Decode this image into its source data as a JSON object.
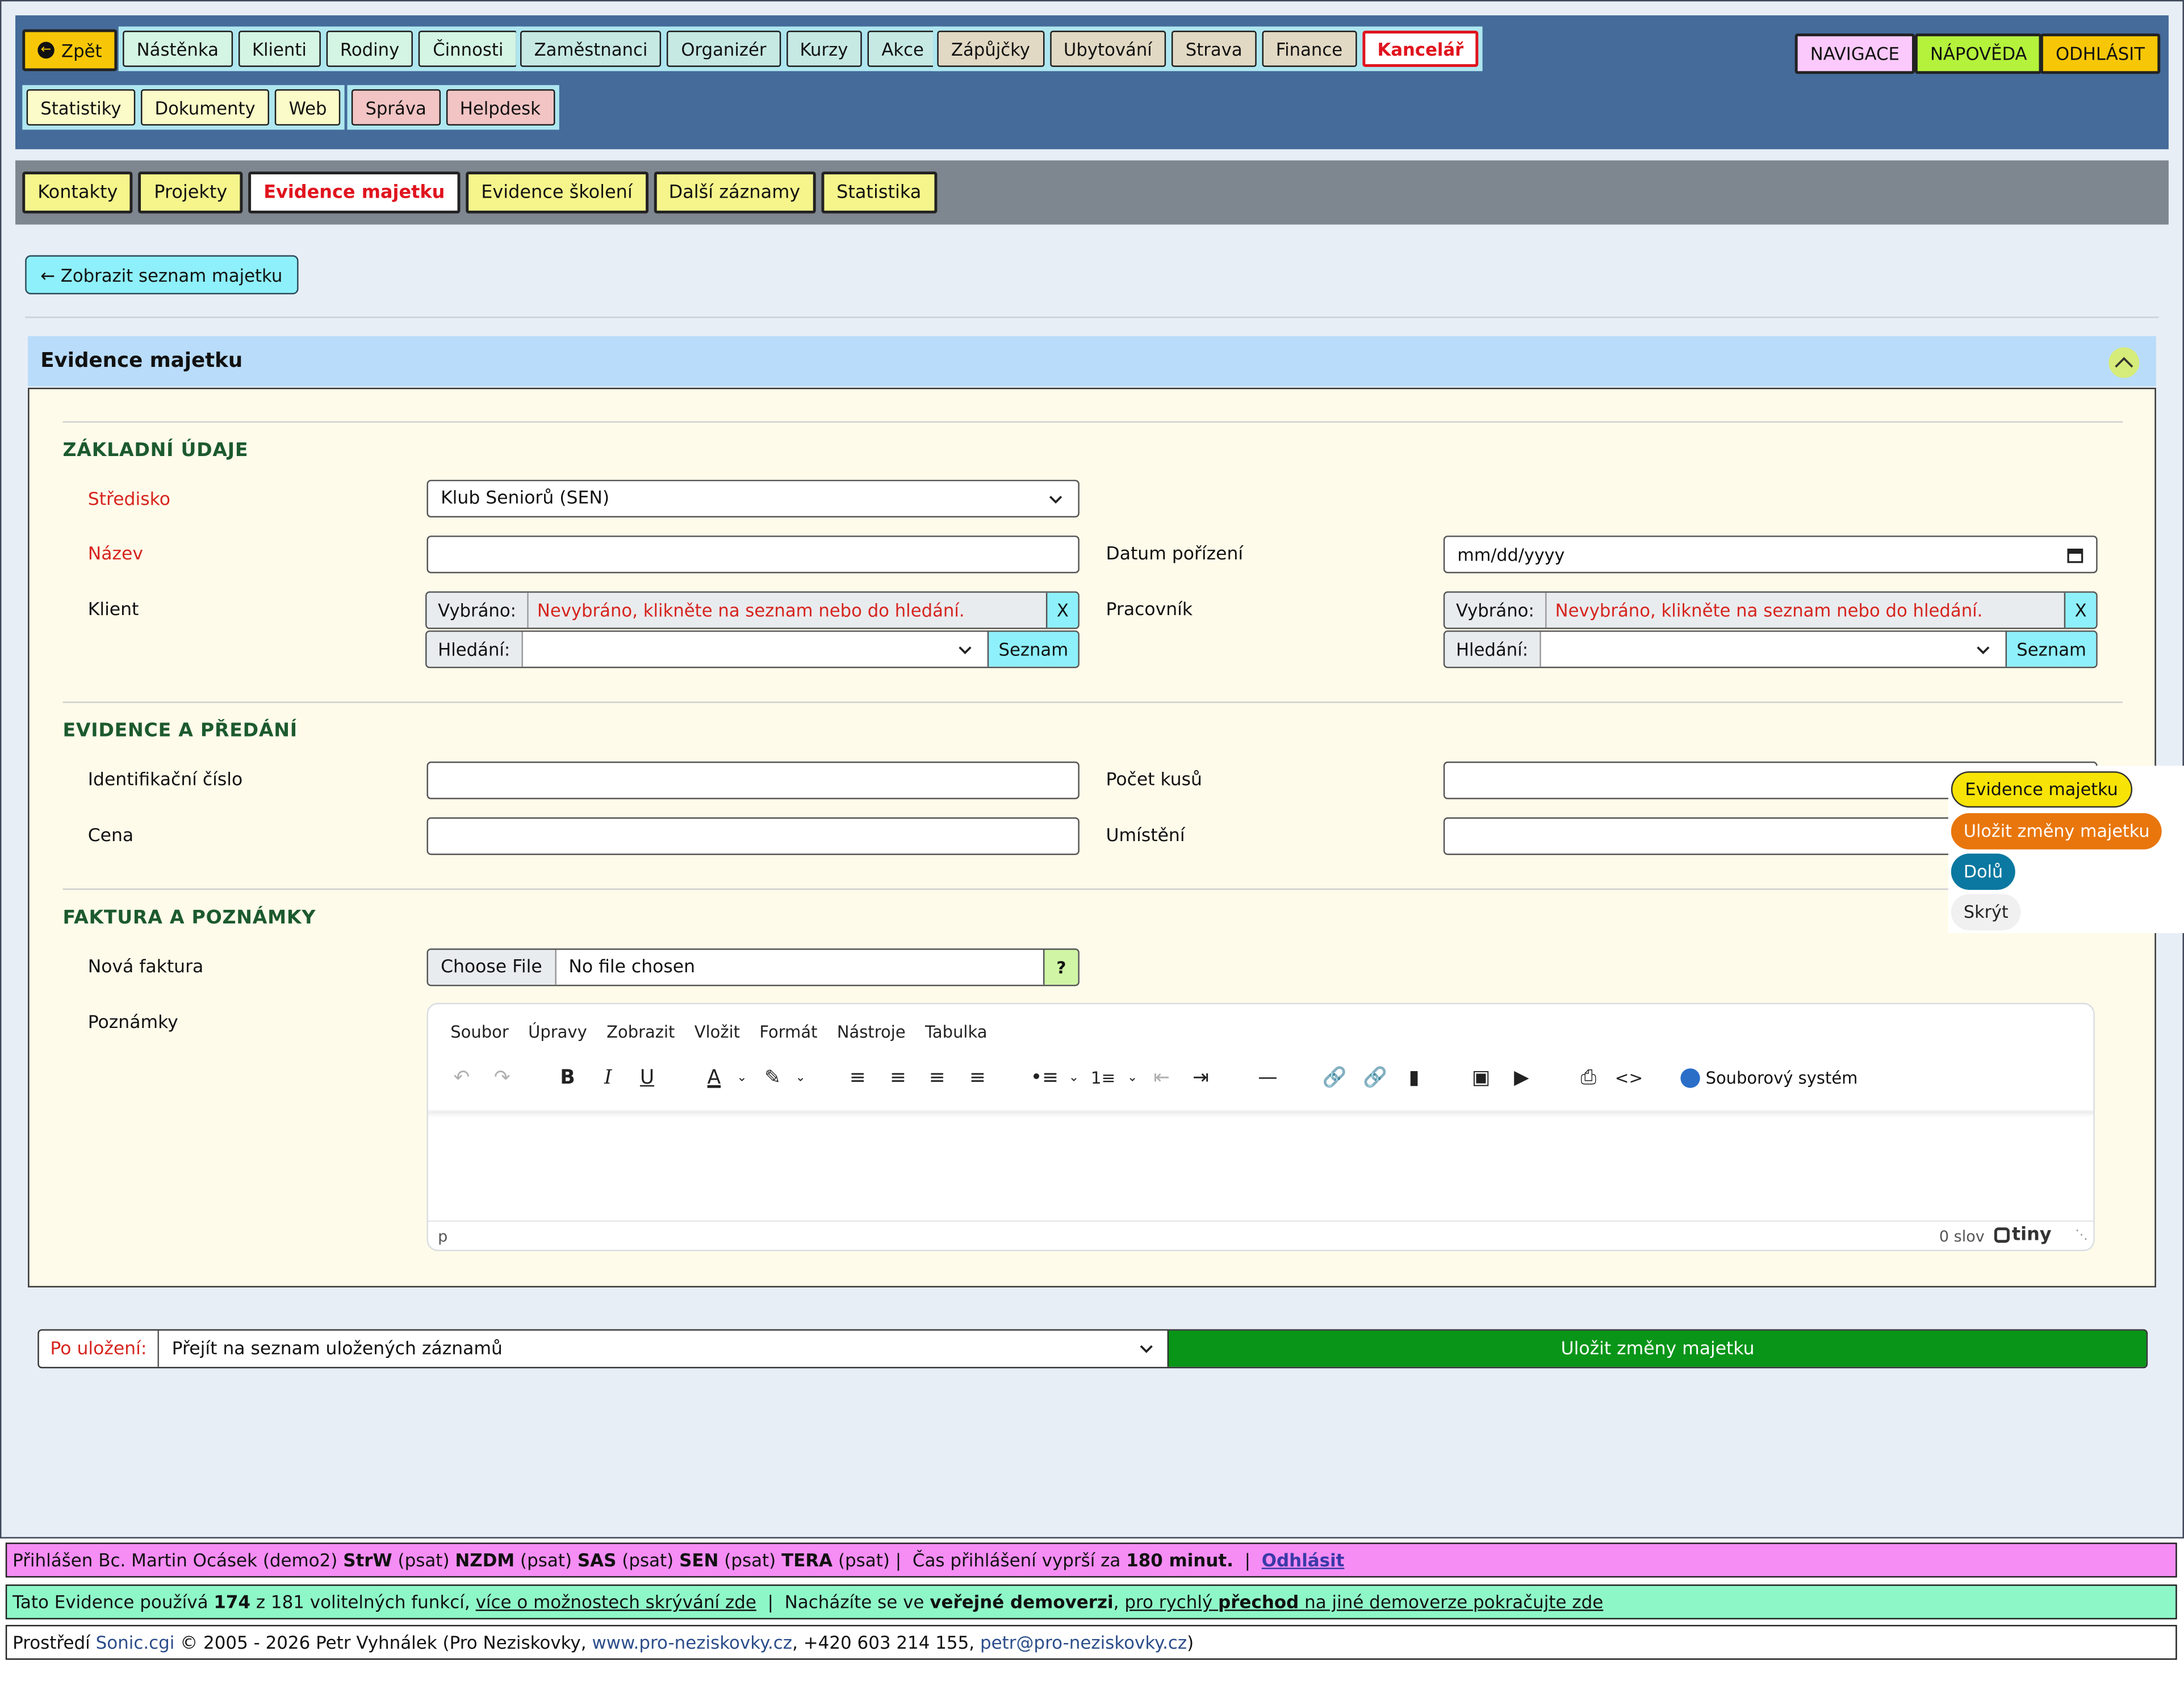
{
  "topnav": {
    "back_label": "Zpět",
    "group1": [
      "Nástěnka",
      "Klienti",
      "Rodiny",
      "Činnosti"
    ],
    "group2": [
      "Zaměstnanci",
      "Organizér",
      "Kurzy",
      "Akce"
    ],
    "group3": [
      "Zápůjčky",
      "Ubytování",
      "Strava",
      "Finance"
    ],
    "active": "Kancelář",
    "group4": [
      "Statistiky",
      "Dokumenty",
      "Web"
    ],
    "group5": [
      "Správa",
      "Helpdesk"
    ],
    "navigace": "NAVIGACE",
    "napoveda": "NÁPOVĚDA",
    "odhlasit": "ODHLÁSIT"
  },
  "subnav": {
    "items": [
      "Kontakty",
      "Projekty",
      "Evidence majetku",
      "Evidence školení",
      "Další záznamy",
      "Statistika"
    ],
    "active_index": 2
  },
  "back_link": "Zobrazit seznam majetku",
  "card_title": "Evidence majetku",
  "sections": {
    "basic": "ZÁKLADNÍ ÚDAJE",
    "handover": "EVIDENCE A PŘEDÁNÍ",
    "invoice": "FAKTURA A POZNÁMKY"
  },
  "fields": {
    "stredisko_label": "Středisko",
    "stredisko_value": "Klub Seniorů (SEN)",
    "nazev_label": "Název",
    "datum_label": "Datum pořízení",
    "datum_placeholder": "mm/dd/yyyy",
    "klient_label": "Klient",
    "pracovnik_label": "Pracovník",
    "vybrano_tag": "Vybráno:",
    "vybrano_value": "Nevybráno, klikněte na seznam nebo do hledání.",
    "clear_label": "X",
    "hledani_tag": "Hledání:",
    "seznam_label": "Seznam",
    "id_label": "Identifikační číslo",
    "pocet_label": "Počet kusů",
    "cena_label": "Cena",
    "umisteni_label": "Umístění",
    "faktura_label": "Nová faktura",
    "choose_file": "Choose File",
    "no_file": "No file chosen",
    "help_label": "?",
    "poznamky_label": "Poznámky"
  },
  "editor": {
    "menu": [
      "Soubor",
      "Úpravy",
      "Zobrazit",
      "Vložit",
      "Formát",
      "Nástroje",
      "Tabulka"
    ],
    "file_system": "Souborový systém",
    "status_path": "p",
    "word_count": "0 slov",
    "brand": "tiny"
  },
  "floating": {
    "evidence": "Evidence majetku",
    "save": "Uložit změny majetku",
    "down": "Dolů",
    "hide": "Skrýt"
  },
  "bottom": {
    "after_save_label": "Po uložení:",
    "after_save_value": "Přejít na seznam uložených záznamů",
    "save_button": "Uložit změny majetku"
  },
  "footer": {
    "login_prefix": "Přihlášen Bc. Martin Ocásek (demo2)",
    "orgs": [
      {
        "code": "StrW",
        "note": "(psat)"
      },
      {
        "code": "NZDM",
        "note": "(psat)"
      },
      {
        "code": "SAS",
        "note": "(psat)"
      },
      {
        "code": "SEN",
        "note": "(psat)"
      },
      {
        "code": "TERA",
        "note": "(psat)"
      }
    ],
    "expire_text": "Čas přihlášení vyprší za",
    "expire_value": "180 minut.",
    "logout": "Odhlásit",
    "features_prefix": "Tato Evidence používá",
    "features_used": "174",
    "features_total": "z 181 volitelných funkcí,",
    "features_link": "více o možnostech skrývání zde",
    "demo_prefix": "Nacházíte se ve",
    "demo_bold": "veřejné demoverzi",
    "demo_link_a": "pro rychlý",
    "demo_link_b": "přechod",
    "demo_link_c": "na jiné demoverze pokračujte zde",
    "copyright_prefix": "Prostředí",
    "copyright_app": "Sonic.cgi",
    "copyright_text": "© 2005 - 2026 Petr Vyhnálek (Pro Neziskovky,",
    "website": "www.pro-neziskovky.cz",
    "phone": ", +420 603 214 155,",
    "email": "petr@pro-neziskovky.cz",
    "close": ")"
  },
  "colors": {
    "topnav_bg": "#446b9a",
    "active_red": "#e0141e",
    "save_green": "#089518",
    "footer_login_bg": "#f58df5",
    "footer_features_bg": "#8ef7c8"
  }
}
